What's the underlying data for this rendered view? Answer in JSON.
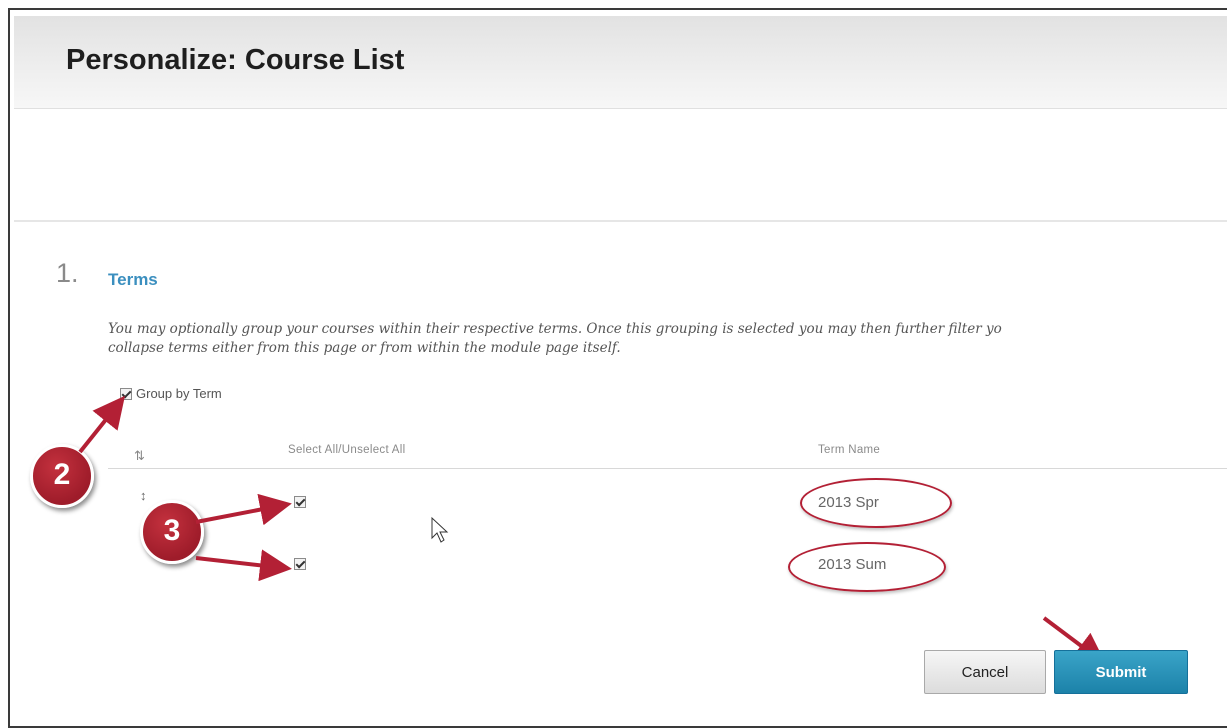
{
  "page": {
    "title": "Personalize: Course List"
  },
  "section": {
    "number": "1.",
    "title": "Terms",
    "instructions_line1": "You may optionally group your courses within their respective terms. Once this grouping is selected you may then further filter yo",
    "instructions_line2": "collapse terms either from this page or from within the module page itself."
  },
  "group_by_term": {
    "label": "Group by Term",
    "checked": true
  },
  "table": {
    "columns": [
      "Select All/Unselect All",
      "Term Name"
    ],
    "rows": [
      {
        "checked": true,
        "term": "2013 Spr"
      },
      {
        "checked": true,
        "term": "2013 Sum"
      }
    ]
  },
  "annotations": {
    "badge2": "2",
    "badge3": "3",
    "highlight_color": "#b32035"
  },
  "buttons": {
    "cancel": "Cancel",
    "submit": "Submit"
  },
  "icons": [
    "sort-icon",
    "mouse-cursor-icon",
    "checkbox-checked-icon"
  ]
}
